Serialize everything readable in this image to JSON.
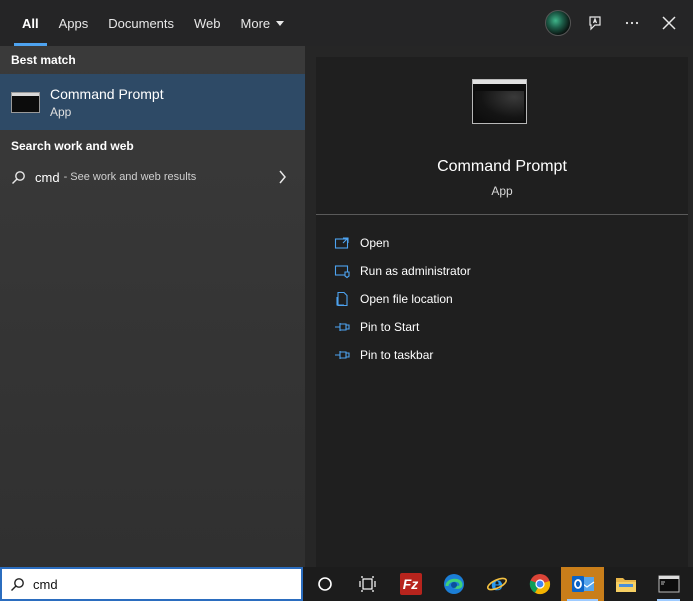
{
  "tabs": [
    {
      "label": "All",
      "active": true
    },
    {
      "label": "Apps",
      "active": false
    },
    {
      "label": "Documents",
      "active": false
    },
    {
      "label": "Web",
      "active": false
    },
    {
      "label": "More",
      "active": false
    }
  ],
  "left": {
    "best_match_heading": "Best match",
    "best_match": {
      "title": "Command Prompt",
      "subtitle": "App",
      "icon": "command-prompt-icon"
    },
    "web_heading": "Search work and web",
    "web_result": {
      "term": "cmd",
      "description": "- See work and web results"
    }
  },
  "preview": {
    "title": "Command Prompt",
    "subtitle": "App",
    "actions": [
      {
        "label": "Open",
        "icon": "open-icon"
      },
      {
        "label": "Run as administrator",
        "icon": "run-as-admin-icon"
      },
      {
        "label": "Open file location",
        "icon": "file-location-icon"
      },
      {
        "label": "Pin to Start",
        "icon": "pin-icon"
      },
      {
        "label": "Pin to taskbar",
        "icon": "pin-icon"
      }
    ]
  },
  "search": {
    "value": "cmd"
  },
  "taskbar": {
    "apps": [
      "cortana",
      "task-view",
      "filezilla",
      "edge",
      "internet-explorer",
      "chrome",
      "outlook",
      "file-explorer",
      "command-prompt"
    ],
    "filezilla_letters": "Fz",
    "active_app": "outlook"
  },
  "colors": {
    "accent": "#4ea3f0",
    "selected_row": "#2e4a66",
    "search_border": "#2b6dbf",
    "outlook_active": "#c97e1a"
  }
}
